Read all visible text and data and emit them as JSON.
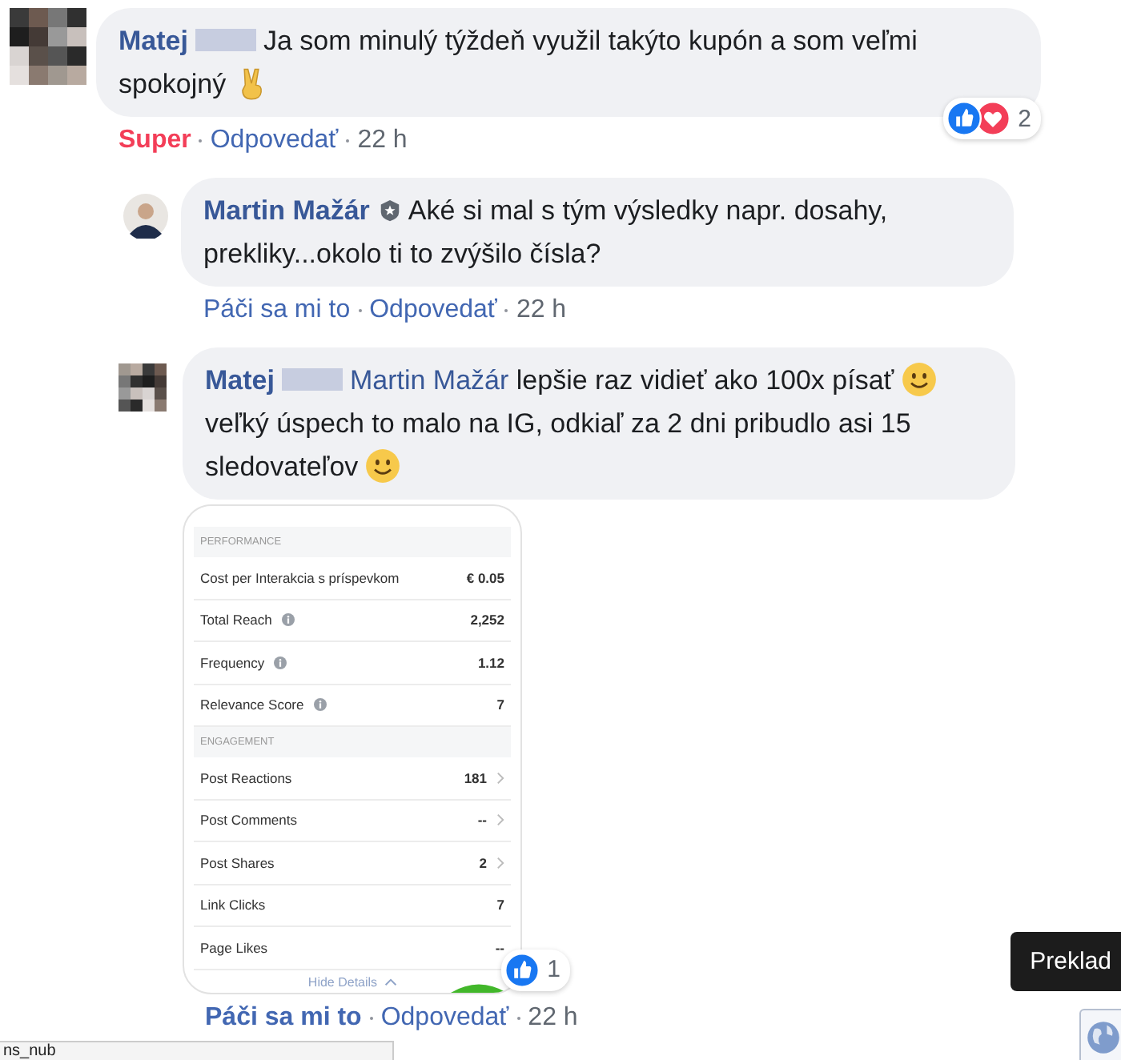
{
  "comments": [
    {
      "author": "Matej",
      "author_blurred": true,
      "avatar": {
        "kind": "pixelated"
      },
      "verified": false,
      "text": [
        {
          "kind": "text",
          "text": "Ja som minulý týždeň využil takýto kupón a som veľmi spokojný"
        },
        {
          "kind": "peace"
        }
      ],
      "reactions": [
        {
          "kind": "like"
        },
        {
          "kind": "love"
        }
      ],
      "reaction_count": "2",
      "actions": {
        "reaction_label": "Super",
        "reacted": true,
        "kind": "love",
        "reply": "Odpovedať",
        "time": "22 h"
      },
      "replies": [
        {
          "author": "Martin Mažár",
          "author_blurred": false,
          "avatar": {
            "kind": "photo"
          },
          "verified": true,
          "text": [
            {
              "kind": "text",
              "text": "Aké si mal s tým výsledky napr. dosahy, prekliky...okolo ti to zvýšilo čísla?"
            }
          ],
          "actions": {
            "reaction_label": "Páči sa mi to",
            "reacted": false,
            "reply": "Odpovedať",
            "time": "22 h"
          }
        },
        {
          "author": "Matej",
          "author_blurred": true,
          "avatar": {
            "kind": "pixelated"
          },
          "verified": false,
          "text": [
            {
              "kind": "mention",
              "text": "Martin Mažár"
            },
            {
              "kind": "text",
              "text": "lepšie raz vidieť ako 100x písať"
            },
            {
              "kind": "smiley"
            },
            {
              "kind": "text",
              "text": "veľký úspech to malo na IG, odkiaľ za 2 dni pribudlo asi 15 sledovateľov"
            },
            {
              "kind": "smiley"
            }
          ],
          "attachment": {
            "sections": [
              {
                "title": "PERFORMANCE",
                "rows": [
                  {
                    "label": "Cost per Interakcia s príspevkom",
                    "info": false,
                    "value": "€ 0.05",
                    "chevron": false
                  },
                  {
                    "label": "Total Reach",
                    "info": true,
                    "value": "2,252",
                    "chevron": false
                  },
                  {
                    "label": "Frequency",
                    "info": true,
                    "value": "1.12",
                    "chevron": false
                  },
                  {
                    "label": "Relevance Score",
                    "info": true,
                    "value": "7",
                    "chevron": false
                  }
                ]
              },
              {
                "title": "ENGAGEMENT",
                "rows": [
                  {
                    "label": "Post Reactions",
                    "info": false,
                    "value": "181",
                    "chevron": true
                  },
                  {
                    "label": "Post Comments",
                    "info": false,
                    "value": "--",
                    "chevron": true
                  },
                  {
                    "label": "Post Shares",
                    "info": false,
                    "value": "2",
                    "chevron": true
                  },
                  {
                    "label": "Link Clicks",
                    "info": false,
                    "value": "7",
                    "chevron": false
                  },
                  {
                    "label": "Page Likes",
                    "info": false,
                    "value": "--",
                    "chevron": false
                  }
                ]
              }
            ],
            "footer": "Hide Details"
          },
          "reactions": [
            {
              "kind": "like"
            }
          ],
          "reaction_count": "1",
          "actions": {
            "reaction_label": "Páči sa mi to",
            "reacted": true,
            "reply": "Odpovedať",
            "time": "22 h"
          }
        }
      ]
    }
  ],
  "status_bar": {
    "text": "ns_nub"
  },
  "tooltip": {
    "text": "Preklad"
  }
}
